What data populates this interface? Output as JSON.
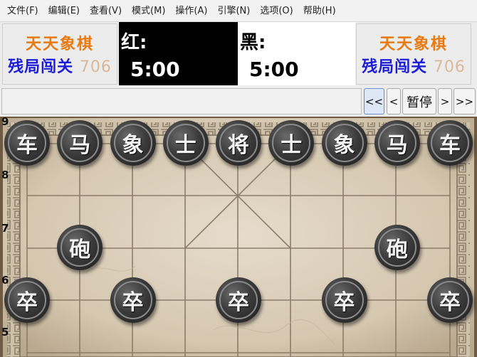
{
  "menu": [
    "文件(F)",
    "编辑(E)",
    "查看(V)",
    "模式(M)",
    "操作(A)",
    "引擎(N)",
    "选项(O)",
    "帮助(H)"
  ],
  "logo": {
    "line1": "天天象棋",
    "line2": "残局闯关",
    "number": "706"
  },
  "clocks": {
    "red": {
      "label": "红:",
      "time": "5:00"
    },
    "black": {
      "label": "黑:",
      "time": "5:00"
    }
  },
  "toolbar": {
    "first": "<<",
    "prev": "<",
    "pause": "暂停",
    "next": ">",
    "last": ">>"
  },
  "board": {
    "row_labels": [
      "9",
      "8",
      "7",
      "6",
      "5"
    ],
    "pieces": [
      {
        "char": "车",
        "file": 0,
        "rank": 9
      },
      {
        "char": "马",
        "file": 1,
        "rank": 9
      },
      {
        "char": "象",
        "file": 2,
        "rank": 9
      },
      {
        "char": "士",
        "file": 3,
        "rank": 9
      },
      {
        "char": "将",
        "file": 4,
        "rank": 9
      },
      {
        "char": "士",
        "file": 5,
        "rank": 9
      },
      {
        "char": "象",
        "file": 6,
        "rank": 9
      },
      {
        "char": "马",
        "file": 7,
        "rank": 9
      },
      {
        "char": "车",
        "file": 8,
        "rank": 9
      },
      {
        "char": "砲",
        "file": 1,
        "rank": 7
      },
      {
        "char": "砲",
        "file": 7,
        "rank": 7
      },
      {
        "char": "卒",
        "file": 0,
        "rank": 6
      },
      {
        "char": "卒",
        "file": 2,
        "rank": 6
      },
      {
        "char": "卒",
        "file": 4,
        "rank": 6
      },
      {
        "char": "卒",
        "file": 6,
        "rank": 6
      },
      {
        "char": "卒",
        "file": 8,
        "rank": 6
      }
    ],
    "colors": {
      "wood": "#d9cbb4",
      "line": "#8b7d6a",
      "piece": "#2b2b2b"
    }
  }
}
